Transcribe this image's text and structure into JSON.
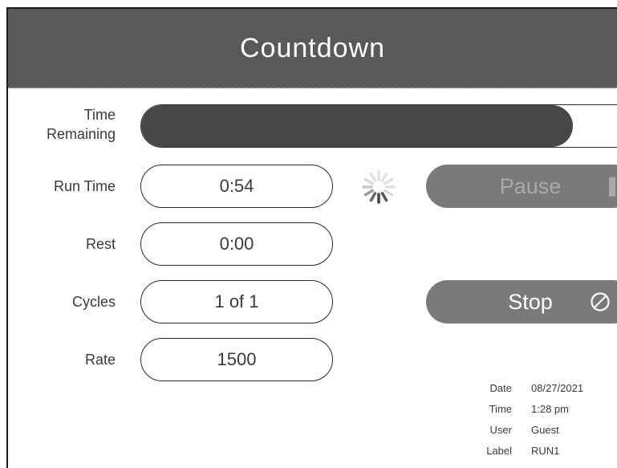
{
  "header": {
    "title": "Countdown"
  },
  "time_remaining": {
    "label_line1": "Time",
    "label_line2": "Remaining",
    "progress_fraction": 0.87
  },
  "fields": {
    "run_time": {
      "label": "Run Time",
      "value": "0:54"
    },
    "rest": {
      "label": "Rest",
      "value": "0:00"
    },
    "cycles": {
      "label": "Cycles",
      "value": "1 of 1"
    },
    "rate": {
      "label": "Rate",
      "value": "1500"
    }
  },
  "buttons": {
    "pause": {
      "label": "Pause",
      "icon": "pause-icon",
      "state": "disabled"
    },
    "stop": {
      "label": "Stop",
      "icon": "stop-icon"
    }
  },
  "spinner": {
    "icon": "loading-spinner-icon"
  },
  "run_info": {
    "date_label": "Date",
    "date_value": "08/27/2021",
    "time_label": "Time",
    "time_value": "1:28 pm",
    "user_label": "User",
    "user_value": "Guest",
    "label_label": "Label",
    "label_value": "RUN1"
  },
  "colors": {
    "header_bg": "#595959",
    "progress_fill": "#474747",
    "button_bg": "#7a7a7a",
    "pause_text": "#a9a9a9",
    "stop_text": "#ffffff"
  }
}
